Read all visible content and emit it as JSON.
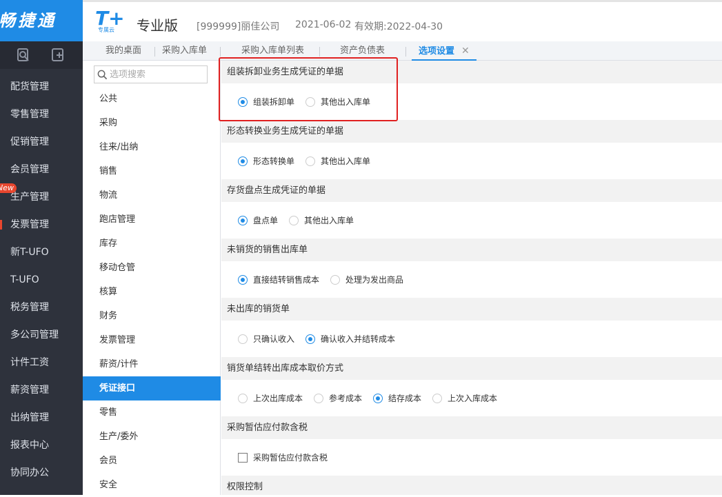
{
  "app": {
    "brand": "畅捷通"
  },
  "header": {
    "logo_text": "T+",
    "logo_sub": "专属云",
    "edition": "专业版",
    "company": "[999999]丽佳公司",
    "date": "2021-06-02",
    "validity": "有效期:2022-04-30"
  },
  "sidebar": {
    "new_badge": "New",
    "items": [
      {
        "label": "配货管理"
      },
      {
        "label": "零售管理"
      },
      {
        "label": "促销管理"
      },
      {
        "label": "会员管理"
      },
      {
        "label": "生产管理"
      },
      {
        "label": "发票管理"
      },
      {
        "label": "新T-UFO"
      },
      {
        "label": "T-UFO"
      },
      {
        "label": "税务管理"
      },
      {
        "label": "多公司管理"
      },
      {
        "label": "计件工资"
      },
      {
        "label": "薪资管理"
      },
      {
        "label": "出纳管理"
      },
      {
        "label": "报表中心"
      },
      {
        "label": "协同办公"
      }
    ]
  },
  "tabs": [
    {
      "label": "我的桌面"
    },
    {
      "label": "采购入库单"
    },
    {
      "label": "采购入库单列表"
    },
    {
      "label": "资产负债表"
    },
    {
      "label": "选项设置",
      "close": "✕"
    }
  ],
  "options_nav": {
    "search_placeholder": "选项搜索",
    "categories": [
      {
        "label": "公共"
      },
      {
        "label": "采购"
      },
      {
        "label": "往来/出纳"
      },
      {
        "label": "销售"
      },
      {
        "label": "物流"
      },
      {
        "label": "跑店管理"
      },
      {
        "label": "库存"
      },
      {
        "label": "移动仓管"
      },
      {
        "label": "核算"
      },
      {
        "label": "财务"
      },
      {
        "label": "发票管理"
      },
      {
        "label": "薪资/计件"
      },
      {
        "label": "凭证接口"
      },
      {
        "label": "零售"
      },
      {
        "label": "生产/委外"
      },
      {
        "label": "会员"
      },
      {
        "label": "安全"
      }
    ],
    "selected": "凭证接口"
  },
  "sections": [
    {
      "title": "组装拆卸业务生成凭证的单据",
      "options": [
        {
          "label": "组装拆卸单",
          "checked": true
        },
        {
          "label": "其他出入库单",
          "checked": false
        }
      ]
    },
    {
      "title": "形态转换业务生成凭证的单据",
      "options": [
        {
          "label": "形态转换单",
          "checked": true
        },
        {
          "label": "其他出入库单",
          "checked": false
        }
      ]
    },
    {
      "title": "存货盘点生成凭证的单据",
      "options": [
        {
          "label": "盘点单",
          "checked": true
        },
        {
          "label": "其他出入库单",
          "checked": false
        }
      ]
    },
    {
      "title": "未销货的销售出库单",
      "options": [
        {
          "label": "直接结转销售成本",
          "checked": true
        },
        {
          "label": "处理为发出商品",
          "checked": false
        }
      ]
    },
    {
      "title": "未出库的销货单",
      "options": [
        {
          "label": "只确认收入",
          "checked": false
        },
        {
          "label": "确认收入并结转成本",
          "checked": true
        }
      ]
    },
    {
      "title": "销货单结转出库成本取价方式",
      "options": [
        {
          "label": "上次出库成本",
          "checked": false
        },
        {
          "label": "参考成本",
          "checked": false
        },
        {
          "label": "结存成本",
          "checked": true
        },
        {
          "label": "上次入库成本",
          "checked": false
        }
      ]
    },
    {
      "title": "采购暂估应付款含税",
      "checkbox": {
        "label": "采购暂估应付款含税",
        "checked": false
      }
    },
    {
      "title": "权限控制"
    }
  ],
  "colors": {
    "brand": "#1f8be5",
    "sidebar_bg": "#2e323c",
    "highlight": "#e02020"
  }
}
